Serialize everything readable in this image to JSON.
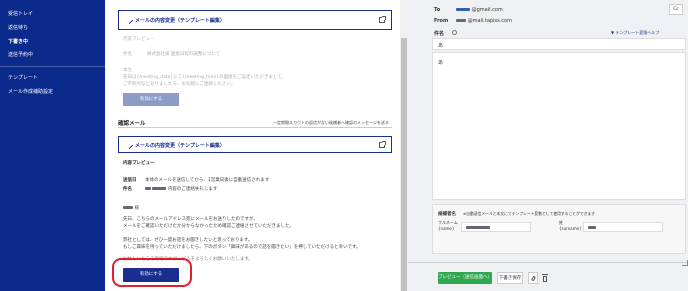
{
  "sidebar": {
    "items": [
      {
        "label": "受信トレイ"
      },
      {
        "label": "返信待ち"
      },
      {
        "label": "下書き中"
      },
      {
        "label": "送信予約中"
      },
      {
        "label": "テンプレート"
      },
      {
        "label": "メール作成補助設定"
      }
    ]
  },
  "middle": {
    "top_edit_label": "メールの内容変更（テンプレート編集）",
    "top_preview_label": "内容プレビュー",
    "top_subject_label": "件名",
    "top_subject_text": "株式会社様 面接日程の調整について",
    "top_body_label": "本文",
    "top_body_line1": "先日は{meeting_date}にて{meeting_time}の面接をご設定いただきまして、",
    "top_body_line2": "ご不明点などありましたら、お気軽にご連絡ください。",
    "top_button": "有効にする",
    "confirm_title": "確認メール",
    "confirm_note": "一定期間スカウトの返信がない候補者へ確認のメッセージを送る",
    "confirm_edit_label": "メールの内容変更（テンプレート編集）",
    "confirm_preview_label": "内容プレビュー",
    "send_time_label": "送信日",
    "send_time_text": "本体のメールを送信してから、1営業日後に自動送信されます",
    "subject_label": "件名",
    "subject_text": "内容のご連絡失礼します",
    "body_greeting": "様",
    "body_line1": "先日、こちらのメールアドレス宛にメールをお送りしたのですが、",
    "body_line2": "メールをご確認いただけたか分からなかったため確認ご連絡させていただきました。",
    "body_line3": "弊社としては、ぜひ一度お話をお聞きしたいと思っております。",
    "body_line4": "もしご興味を持っていただけましたら、下のボタン「興味があるので話を聞きたい」を押していただけると幸いです。",
    "body_line5": "お忙しいところ恐縮ですが、どうぞよろしくお願いいたします。",
    "activate_button": "有効にする"
  },
  "right": {
    "to_label": "To",
    "to_value": "@gmail.com",
    "cc_button": "Cc",
    "from_label": "From",
    "from_value": "@mail.tapiss.com",
    "subject_label": "件名",
    "template_link": "▼ テンプレート変換ヘルプ",
    "subject_value": "あ",
    "body_value": "あ",
    "candidate_label": "候補者名",
    "candidate_note": "※自動送信メールと本文にてテンプレート変数として使用することができます",
    "fullname_label": "フルネーム",
    "fullname_var": "{name}",
    "surname_label": "姓",
    "surname_var": "{surname}",
    "preview_button": "プレビュー（送信画面へ）",
    "save_draft_button": "下書き保存"
  },
  "colors": {
    "sidebar_bg": "#0a2a8c",
    "accent": "#1a2e8f",
    "highlight": "#e31e2b",
    "green": "#2fa84f"
  }
}
